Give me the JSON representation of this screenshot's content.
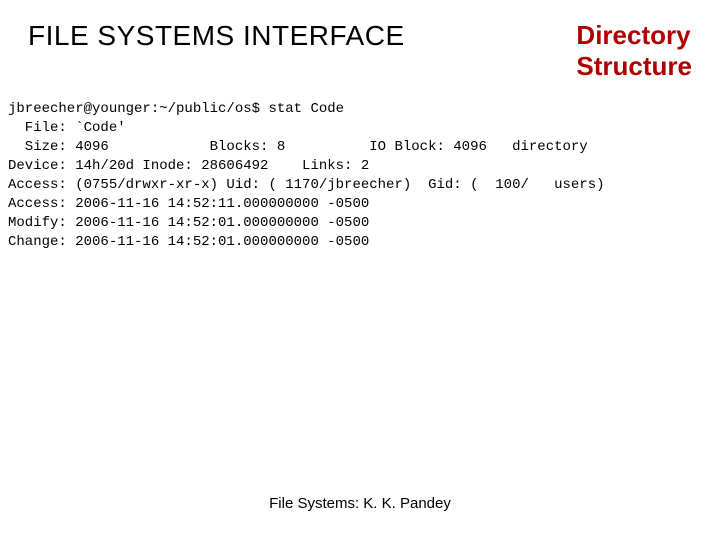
{
  "header": {
    "title_left": "FILE SYSTEMS INTERFACE",
    "title_right": "Directory\nStructure"
  },
  "terminal": {
    "line0": "jbreecher@younger:~/public/os$ stat Code",
    "line1": "  File: `Code'",
    "line2": "  Size: 4096            Blocks: 8          IO Block: 4096   directory",
    "line3": "Device: 14h/20d Inode: 28606492    Links: 2",
    "line4": "Access: (0755/drwxr-xr-x) Uid: ( 1170/jbreecher)  Gid: (  100/   users)",
    "line5": "Access: 2006-11-16 14:52:11.000000000 -0500",
    "line6": "Modify: 2006-11-16 14:52:01.000000000 -0500",
    "line7": "Change: 2006-11-16 14:52:01.000000000 -0500"
  },
  "footer": {
    "text": "File Systems: K. K. Pandey"
  }
}
